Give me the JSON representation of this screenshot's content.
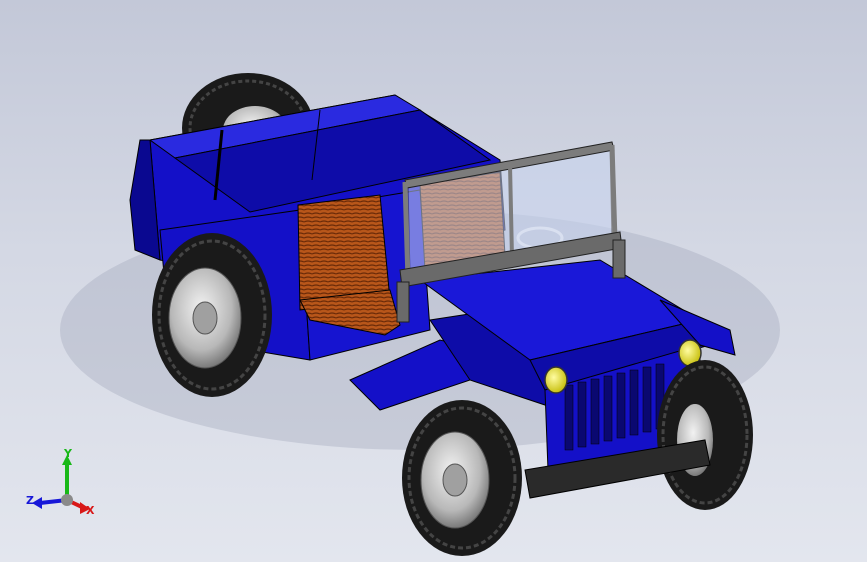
{
  "viewport": {
    "model_name": "",
    "colors": {
      "background_top": "#c3c8d8",
      "background_bottom": "#e3e6ee",
      "body": "#1410c8",
      "body_dark": "#0a0890",
      "body_light": "#2a2ae0",
      "seat": "#b8561a",
      "tire": "#1a1a1a",
      "rim": "#c8c8c8",
      "headlight": "#e6e020",
      "grille": "#1414a0",
      "windshield_frame": "#7c7c7c",
      "bumper": "#2a2a2a"
    }
  },
  "triad": {
    "x_label": "X",
    "y_label": "Y",
    "z_label": "Z",
    "x_color": "#d81818",
    "y_color": "#18b818",
    "z_color": "#1818d8"
  }
}
